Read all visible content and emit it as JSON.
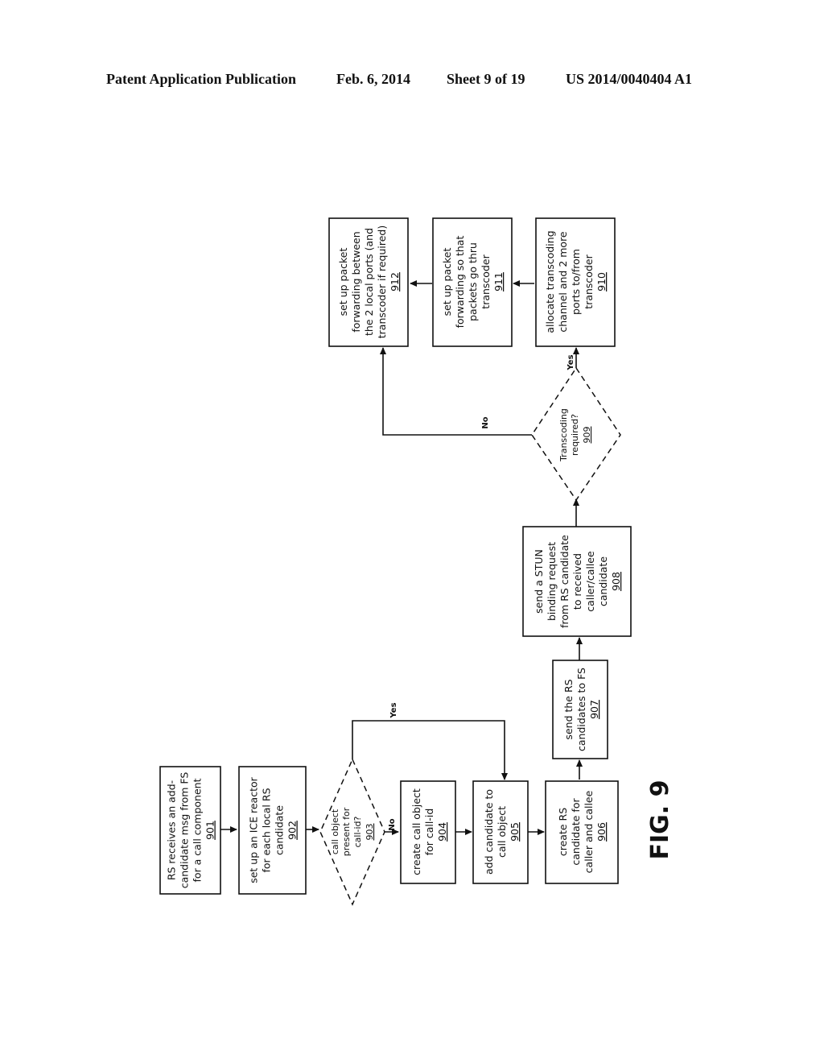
{
  "header": {
    "title": "Patent Application Publication",
    "date": "Feb. 6, 2014",
    "sheet": "Sheet 9 of 19",
    "number": "US 2014/0040404 A1"
  },
  "figure_label": "FIG. 9",
  "steps": {
    "s901": {
      "lines": [
        "RS receives an add-",
        "candidate msg from FS",
        "for a call component"
      ],
      "ref": "901"
    },
    "s902": {
      "lines": [
        "set up an ICE reactor",
        "for each local RS",
        "candidate"
      ],
      "ref": "902"
    },
    "s903": {
      "lines": [
        "call object",
        "present for",
        "call-id?"
      ],
      "ref": "903"
    },
    "s904": {
      "lines": [
        "create call object",
        "for call-id"
      ],
      "ref": "904"
    },
    "s905": {
      "lines": [
        "add candidate to",
        "call object"
      ],
      "ref": "905"
    },
    "s906": {
      "lines": [
        "create RS",
        "candidate for",
        "caller and callee"
      ],
      "ref": "906"
    },
    "s907": {
      "lines": [
        "send the RS",
        "candidates to FS"
      ],
      "ref": "907"
    },
    "s908": {
      "lines": [
        "send a STUN",
        "binding request",
        "from RS candidate",
        "to received",
        "caller/callee",
        "candidate"
      ],
      "ref": "908"
    },
    "s909": {
      "lines": [
        "Transcoding",
        "required?"
      ],
      "ref": "909"
    },
    "s910": {
      "lines": [
        "allocate transcoding",
        "channel and 2 more",
        "ports to/from",
        "transcoder"
      ],
      "ref": "910"
    },
    "s911": {
      "lines": [
        "set up packet",
        "forwarding so that",
        "packets go thru",
        "transcoder"
      ],
      "ref": "911"
    },
    "s912": {
      "lines": [
        "set up packet",
        "forwarding between",
        "the 2 local ports (and",
        "transcoder if required)"
      ],
      "ref": "912"
    }
  },
  "edge_labels": {
    "yes_903": "Yes",
    "no_903": "No",
    "yes_909": "Yes",
    "no_909": "No"
  }
}
